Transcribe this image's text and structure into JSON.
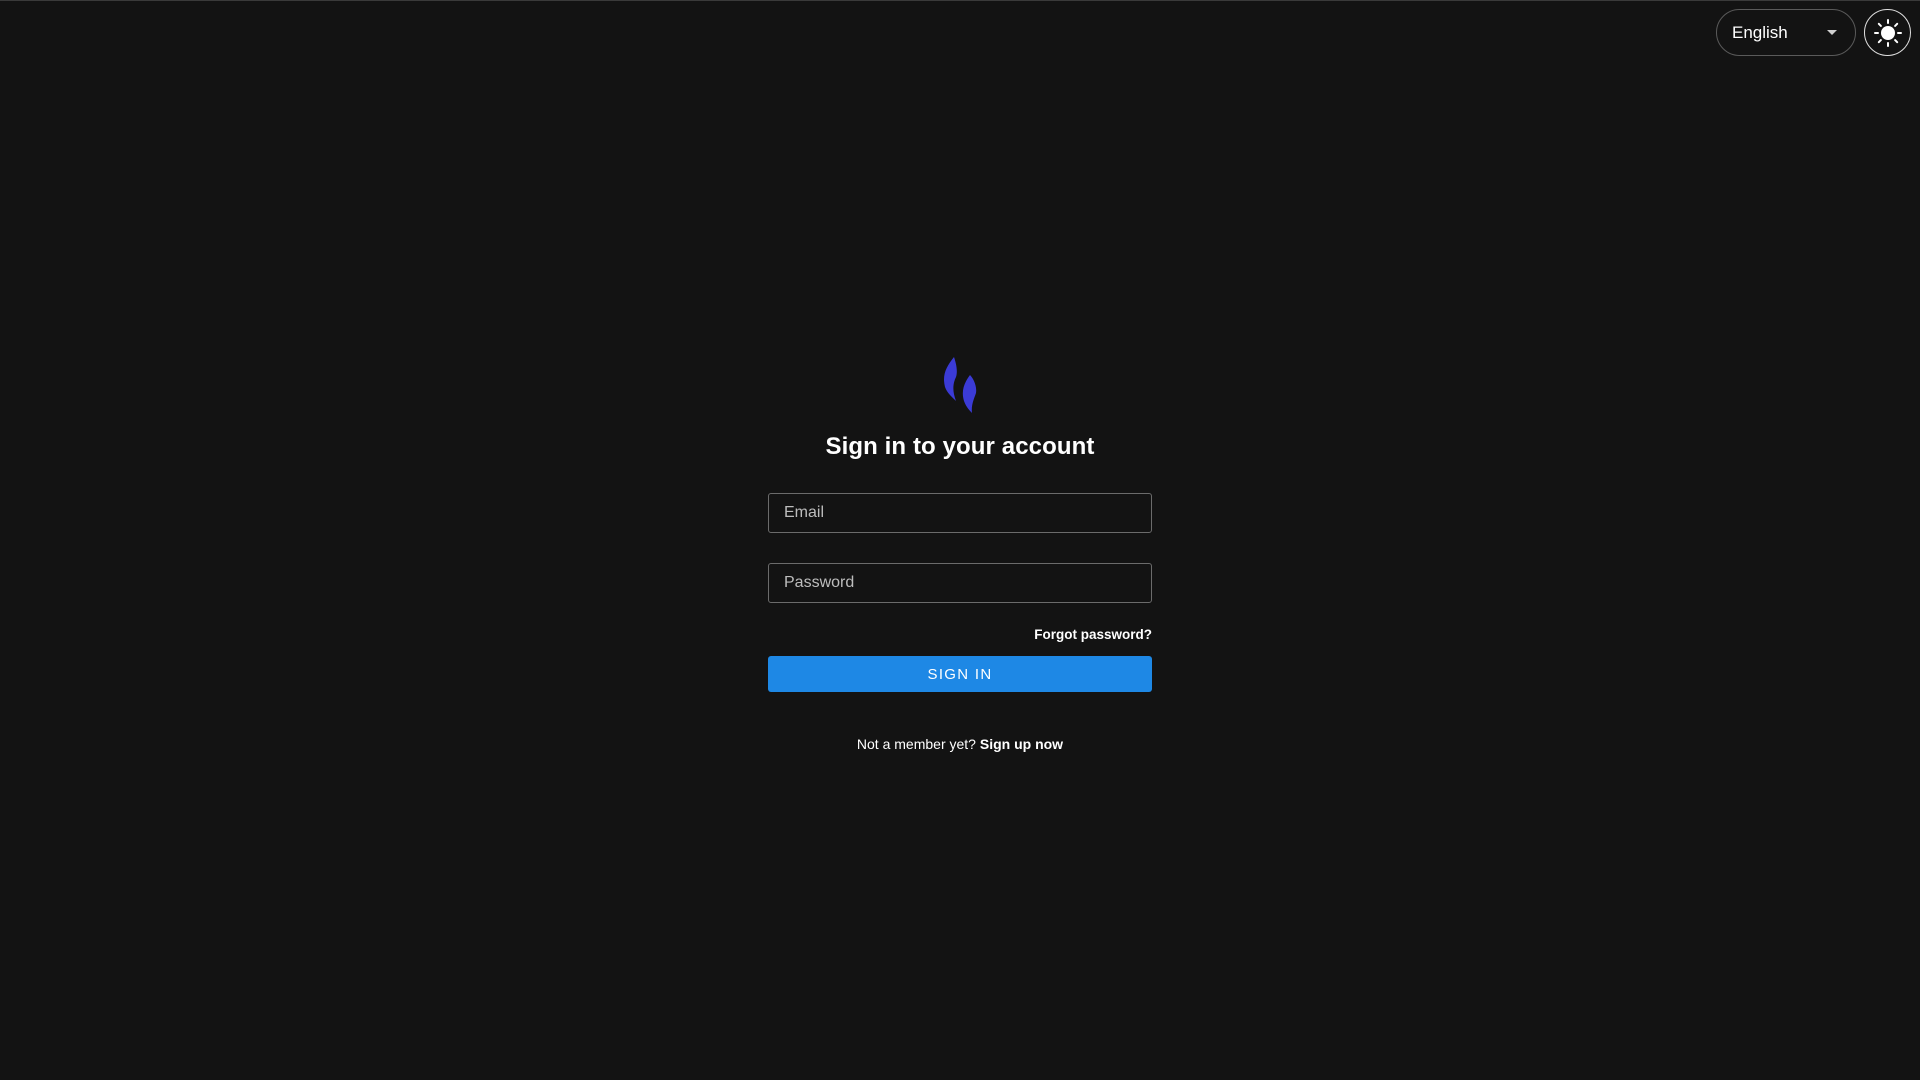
{
  "header": {
    "language_select": {
      "selected": "English",
      "icon": "caret-down-icon"
    },
    "theme_toggle": {
      "icon": "sun-icon"
    }
  },
  "logo": {
    "icon": "flame-logo-icon",
    "color": "#3b3bd6"
  },
  "auth": {
    "title": "Sign in to your account",
    "email": {
      "value": "",
      "placeholder": "Email"
    },
    "password": {
      "value": "",
      "placeholder": "Password"
    },
    "forgot_label": "Forgot password?",
    "submit_label": "SIGN IN",
    "signup_prompt": "Not a member yet?",
    "signup_link": "Sign up now"
  },
  "colors": {
    "background": "#131313",
    "primary": "#1e88e5",
    "text": "#ffffff"
  }
}
